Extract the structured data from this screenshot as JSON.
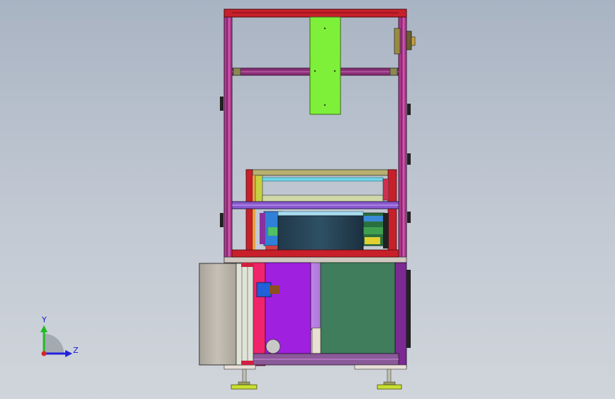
{
  "viewport": {
    "colors": {
      "frame": "#b03a8e",
      "frame_dark": "#5a1f52",
      "rail_red": "#c8202a",
      "panel_green": "#7ef03a",
      "cover_gray": "#bdb8ae",
      "roll_purple": "#9b61c8",
      "base_green": "#3f7d5c",
      "bronze": "#b06830"
    }
  },
  "triad": {
    "y_label": "Y",
    "z_label": "Z",
    "colors": {
      "y": "#22bb22",
      "z": "#2222dd",
      "origin": "#dd2222"
    }
  }
}
